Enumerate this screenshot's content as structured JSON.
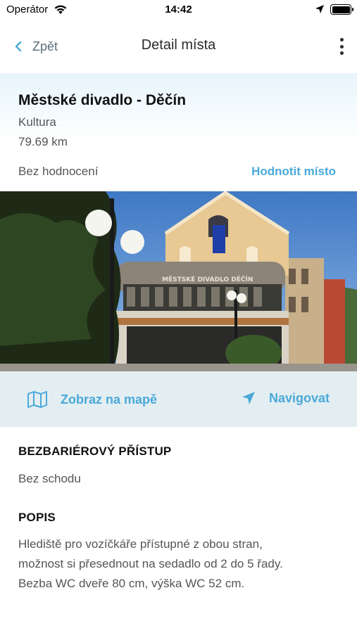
{
  "status_bar": {
    "carrier": "Operátor",
    "time": "14:42"
  },
  "nav": {
    "back_label": "Zpět",
    "title": "Detail místa"
  },
  "place": {
    "name": "Městské divadlo - Děčín",
    "category": "Kultura",
    "distance": "79.69 km",
    "rating_status": "Bez hodnocení",
    "rate_label": "Hodnotit místo",
    "photo_sign": "MĚSTSKÉ DIVADLO DĚČÍN"
  },
  "actions": {
    "map_label": "Zobraz na mapě",
    "navigate_label": "Navigovat"
  },
  "accessibility": {
    "heading": "BEZBARIÉROVÝ PŘÍSTUP",
    "value": "Bez schodu"
  },
  "description": {
    "heading": "POPIS",
    "lines": [
      "Hlediště pro vozíčkáře přístupné z obou stran,",
      "možnost si přesednout na sedadlo od 2 do 5 řady.",
      "Bezba WC dveře 80 cm, výška WC 52 cm."
    ]
  },
  "colors": {
    "accent": "#4aa9d9",
    "action_bar_bg": "#e3eef2"
  }
}
